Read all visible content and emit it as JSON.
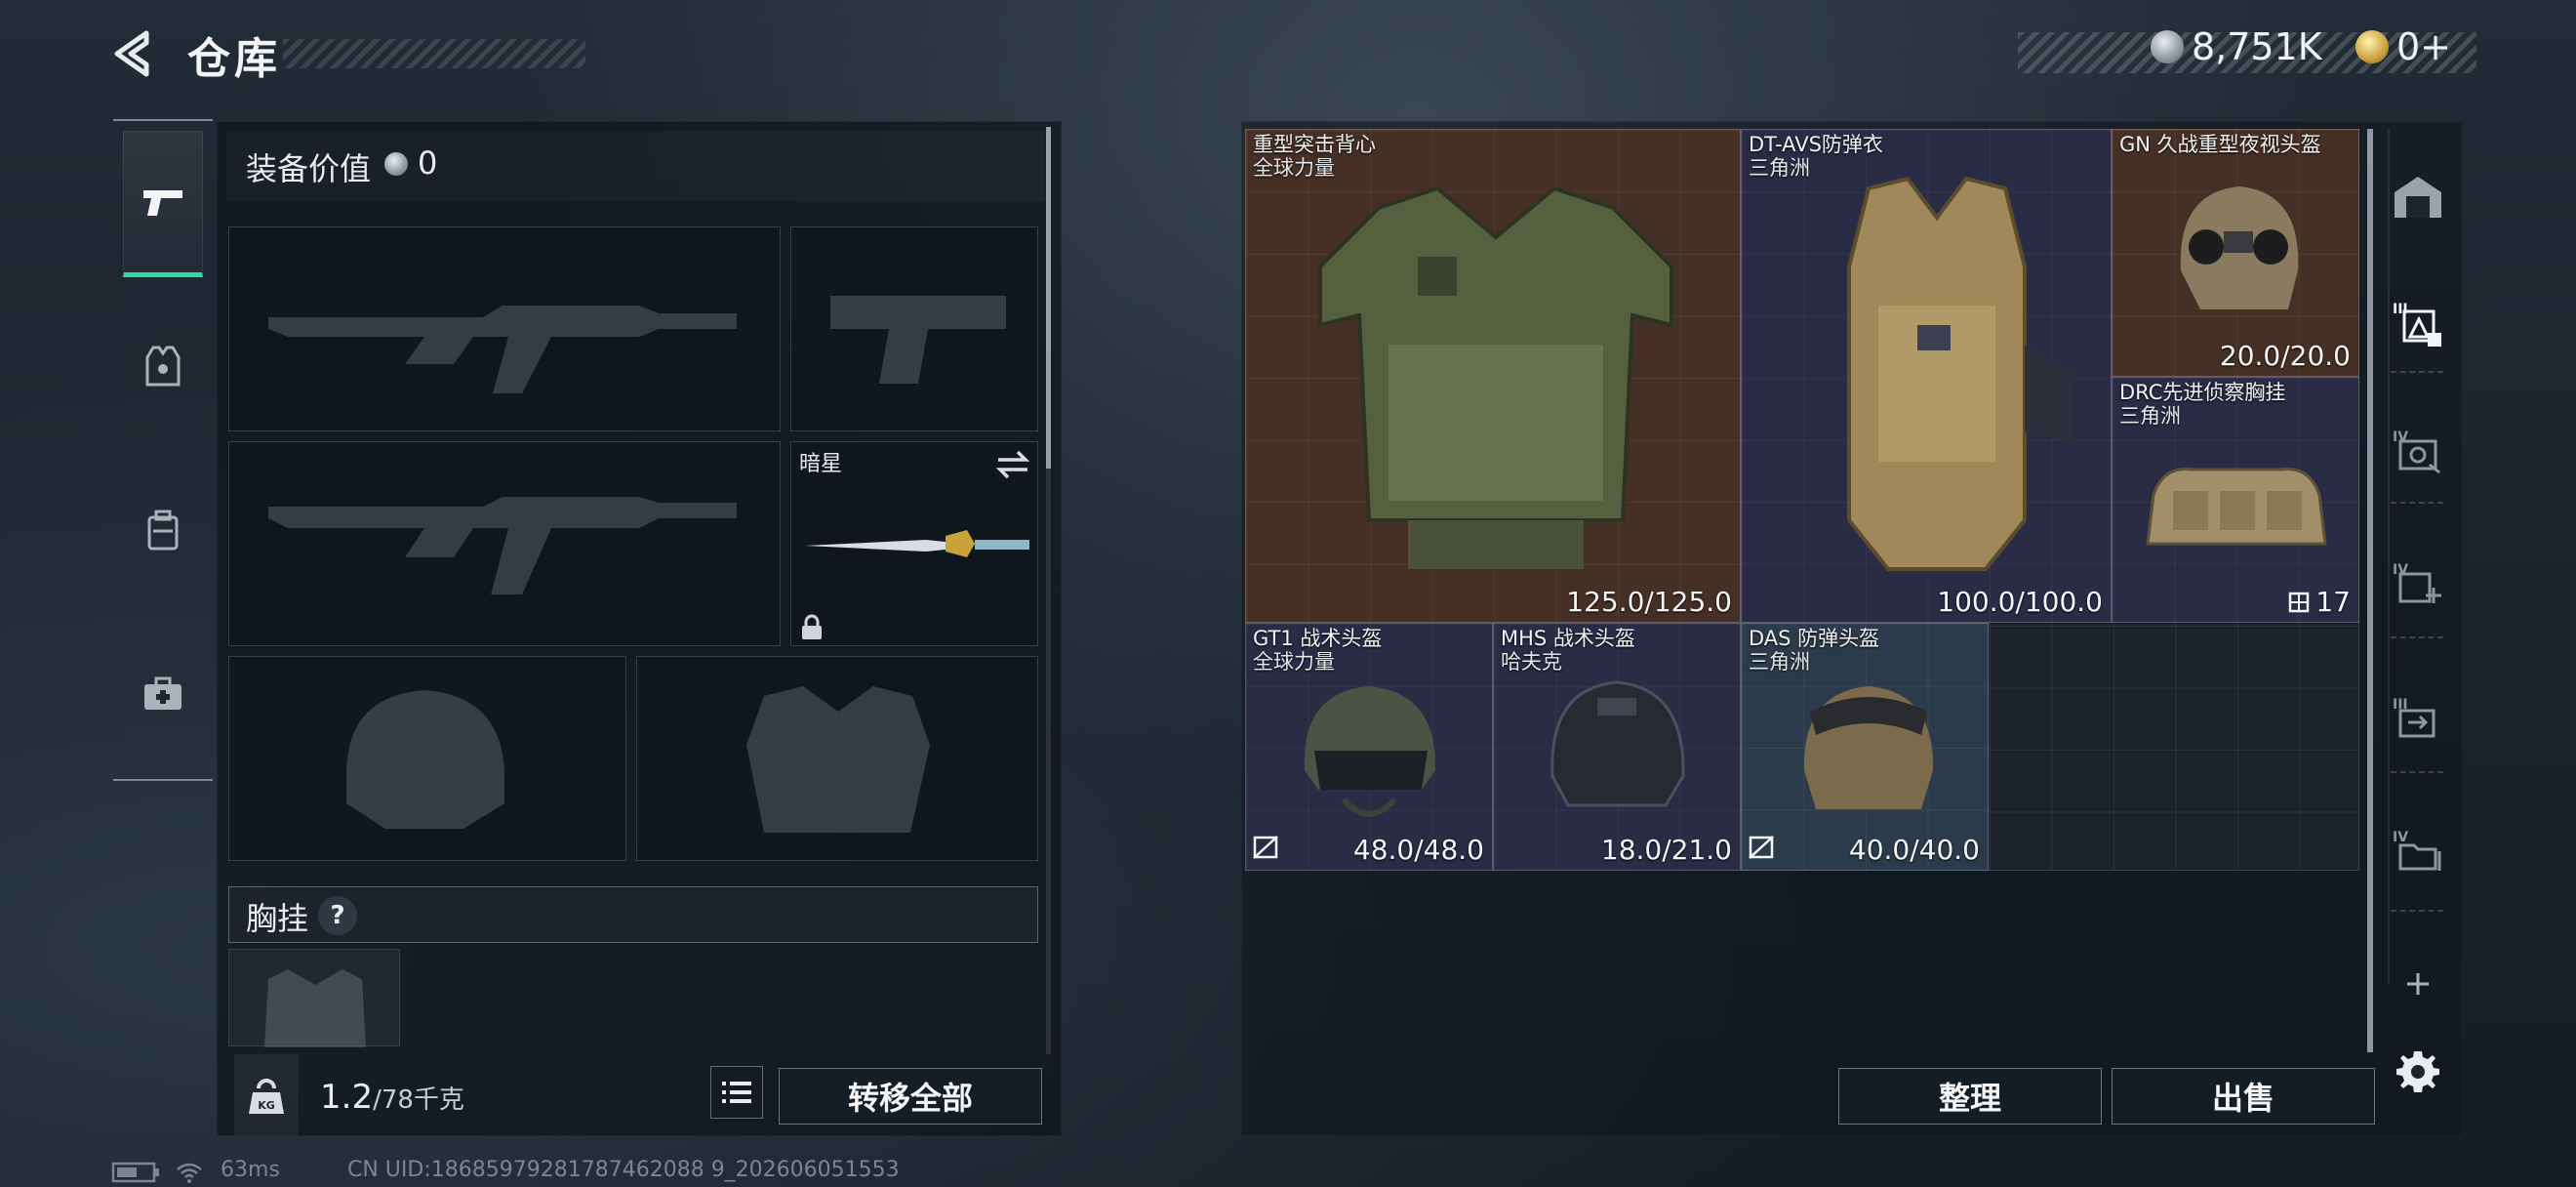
{
  "header": {
    "title": "仓库",
    "currency_silver": "8,751K",
    "currency_gold": "0+"
  },
  "loadout": {
    "equip_value_label": "装备价值",
    "equip_value": "0",
    "melee_name": "暗星",
    "chest_rig_label": "胸挂",
    "help_mark": "?"
  },
  "bottom": {
    "weight_current": "1.2",
    "weight_max": "/78千克",
    "transfer_all": "转移全部",
    "sort": "整理",
    "sell": "出售"
  },
  "stash": {
    "items": [
      {
        "name": "重型突击背心",
        "sub": "全球力量",
        "durability": "125.0/125.0"
      },
      {
        "name": "DT-AVS防弹衣",
        "sub": "三角洲",
        "durability": "100.0/100.0"
      },
      {
        "name": "GN 久战重型夜视头盔",
        "sub": "",
        "durability": "20.0/20.0"
      },
      {
        "name": "DRC先进侦察胸挂",
        "sub": "三角洲",
        "count": "17"
      },
      {
        "name": "GT1 战术头盔",
        "sub": "全球力量",
        "durability": "48.0/48.0"
      },
      {
        "name": "MHS 战术头盔",
        "sub": "哈夫克",
        "durability": "18.0/21.0"
      },
      {
        "name": "DAS 防弹头盔",
        "sub": "三角洲",
        "durability": "40.0/40.0"
      }
    ]
  },
  "status_bar": {
    "ping": "63ms",
    "uid": "CN UID:18685979281787462088 9_202606051553"
  },
  "colors": {
    "accent": "#33d6a6",
    "item_brown": "#463025",
    "item_navy": "#2a2b45",
    "item_steel": "#2c3b4c"
  }
}
